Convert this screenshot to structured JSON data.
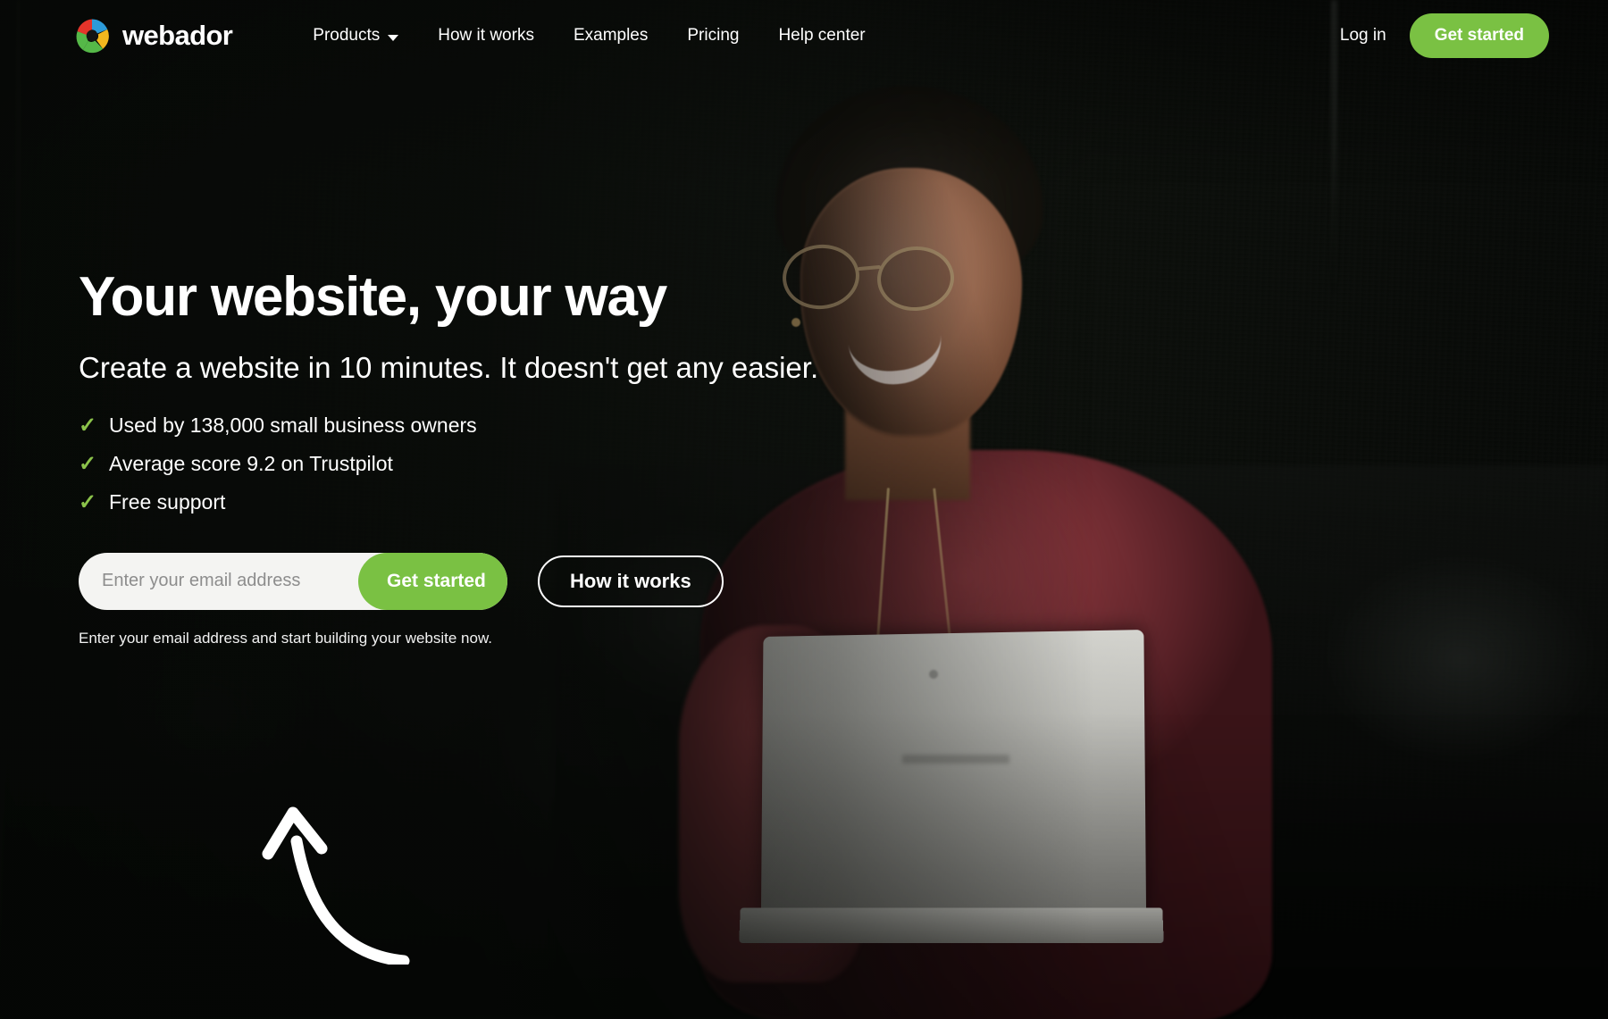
{
  "brand": {
    "name": "webador",
    "logo_icon": "webador-shutter-logo",
    "logo_colors": [
      "#e5342a",
      "#2d9bd9",
      "#f2b81e",
      "#55b848"
    ]
  },
  "header": {
    "nav": [
      {
        "label": "Products",
        "has_dropdown": true,
        "icon": "chevron-down-icon"
      },
      {
        "label": "How it works",
        "has_dropdown": false
      },
      {
        "label": "Examples",
        "has_dropdown": false
      },
      {
        "label": "Pricing",
        "has_dropdown": false
      },
      {
        "label": "Help center",
        "has_dropdown": false
      }
    ],
    "login_label": "Log in",
    "cta_label": "Get started",
    "cta_color": "#7ac143"
  },
  "hero": {
    "headline": "Your website, your way",
    "subheadline": "Create a website in 10 minutes. It doesn't get any easier.",
    "benefits": [
      {
        "check_icon": "check-icon",
        "text": "Used by 138,000 small business owners"
      },
      {
        "check_icon": "check-icon",
        "text": "Average score 9.2 on Trustpilot"
      },
      {
        "check_icon": "check-icon",
        "text": "Free support"
      }
    ],
    "check_color": "#8bc34a",
    "form": {
      "email_placeholder": "Enter your email address",
      "email_value": "",
      "submit_label": "Get started",
      "secondary_label": "How it works",
      "note": "Enter your email address and start building your website now."
    },
    "annotation": {
      "icon": "curved-up-arrow-icon",
      "color": "#ffffff"
    }
  }
}
